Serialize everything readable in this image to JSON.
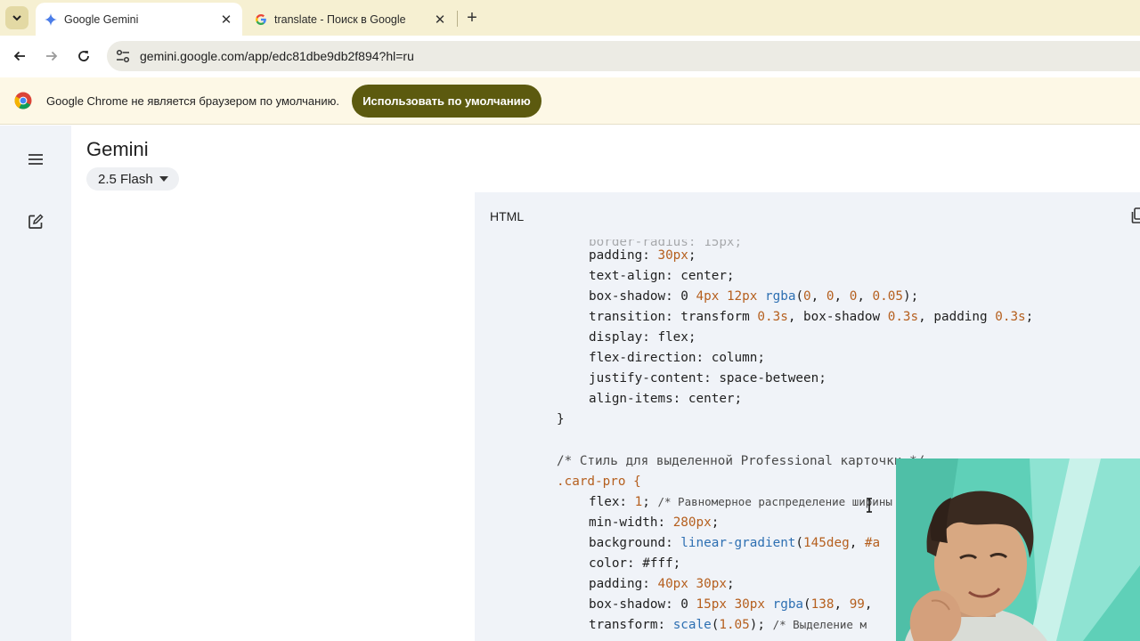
{
  "browser": {
    "tabs": [
      {
        "title": "Google Gemini",
        "favicon": "gemini-sparkle-icon",
        "active": true
      },
      {
        "title": "translate - Поиск в Google",
        "favicon": "google-g-icon",
        "active": false
      }
    ],
    "url": "gemini.google.com/app/edc81dbe9db2f894?hl=ru"
  },
  "infobar": {
    "message": "Google Chrome не является браузером по умолчанию.",
    "button_label": "Использовать по умолчанию"
  },
  "gemini": {
    "title": "Gemini",
    "model": "2.5 Flash",
    "code_language": "HTML"
  },
  "code": {
    "partial_top": "border-radius: 15px;",
    "lines": [
      {
        "p": "padding: ",
        "v": "30px",
        "s": ";"
      },
      {
        "p": "text-align: center;"
      },
      {
        "p": "box-shadow: "
      },
      {
        "p": "transition: transform "
      },
      {
        "p": "display: flex;"
      },
      {
        "p": "flex-direction: column;"
      },
      {
        "p": "justify-content: space-between;"
      },
      {
        "p": "align-items: center;"
      },
      {
        "p": "}"
      },
      {
        "p": "/* Стиль для выделенной Professional карточки */"
      },
      {
        "p": ".card-pro {"
      },
      {
        "p": "flex: "
      },
      {
        "p": "min-width: "
      },
      {
        "p": "background: "
      },
      {
        "p": "color: #fff;"
      },
      {
        "p": "padding: "
      },
      {
        "p": "box-shadow: "
      },
      {
        "p": "transform: "
      }
    ],
    "shadow1": {
      "a": "0 ",
      "b": "4px",
      "c": " ",
      "d": "12px",
      "e": " ",
      "f": "rgba",
      "g": "(",
      "h": "0",
      "i": ", ",
      "j": "0",
      "k": ", ",
      "l": "0",
      "m": ", ",
      "n": "0.05",
      "o": ");"
    },
    "transition": {
      "t1": "0.3s",
      "m1": ", box-shadow ",
      "t2": "0.3s",
      "m2": ", padding ",
      "t3": "0.3s",
      "e": ";"
    },
    "flex": {
      "v": "1",
      "c": "; ",
      "cmt": "/* Равномерное распределение ширины */"
    },
    "minwidth": {
      "v": "280px",
      "e": ";"
    },
    "background": {
      "fn": "linear-gradient",
      "o": "(",
      "deg": "145deg",
      "c": ", ",
      "col": "#a"
    },
    "padding2": {
      "v1": "40px",
      "sp": " ",
      "v2": "30px",
      "e": ";"
    },
    "shadow2": {
      "a": "0 ",
      "b": "15px",
      "c": " ",
      "d": "30px",
      "e": " ",
      "f": "rgba",
      "g": "(",
      "h": "138",
      "i": ", ",
      "j": "99",
      "k": ","
    },
    "transform": {
      "fn": "scale",
      "o": "(",
      "v": "1.05",
      "e": "); ",
      "cmt": "/* Выделение м"
    }
  },
  "colors": {
    "tabstrip": "#f6f0d2",
    "infobar_button": "#5c5a0f",
    "code_number": "#b55f1e",
    "code_function": "#2d6fb2"
  }
}
